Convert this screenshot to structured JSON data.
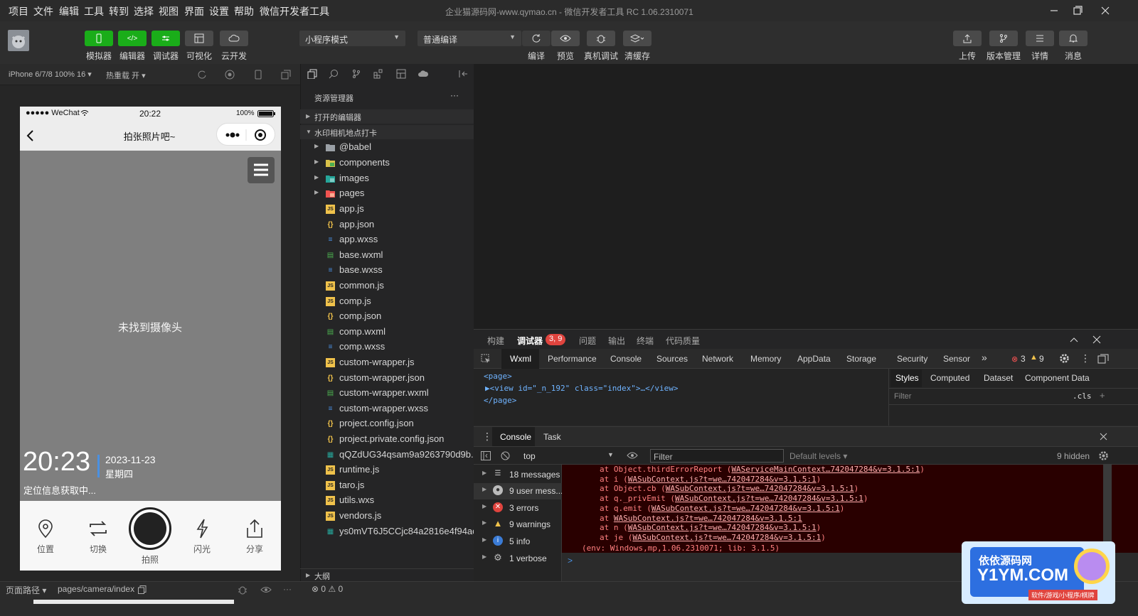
{
  "menubar": {
    "items": [
      "项目",
      "文件",
      "编辑",
      "工具",
      "转到",
      "选择",
      "视图",
      "界面",
      "设置",
      "帮助",
      "微信开发者工具"
    ],
    "window_title": "企业猫源码网-www.qymao.cn - 微信开发者工具 RC 1.06.2310071"
  },
  "toolbar": {
    "buttons": {
      "simulator": "模拟器",
      "editor": "编辑器",
      "debugger": "调试器",
      "visual": "可视化",
      "cloud": "云开发"
    },
    "mode_select": "小程序模式",
    "compile_select": "普通编译",
    "actions": {
      "compile": "编译",
      "preview": "预览",
      "remote_debug": "真机调试",
      "clear_cache": "清缓存"
    },
    "right": {
      "upload": "上传",
      "version": "版本管理",
      "details": "详情",
      "messages": "消息"
    }
  },
  "sim_bar": {
    "device": "iPhone 6/7/8 100% 16 ▾",
    "hot_reload": "热重载 开 ▾"
  },
  "phone": {
    "status": {
      "signal": "●●●●● WeChat",
      "time": "20:22",
      "battery": "100%"
    },
    "nav_title": "拍张照片吧~",
    "camera_msg": "未找到摄像头",
    "overlay": {
      "time": "20:23",
      "date": "2023-11-23",
      "weekday": "星期四",
      "location": "定位信息获取中..."
    },
    "bottom": {
      "location": "位置",
      "switch": "切换",
      "shoot": "拍照",
      "flash": "闪光",
      "share": "分享"
    }
  },
  "explorer": {
    "title": "资源管理器",
    "more": "···",
    "open_editors": "打开的编辑器",
    "project": "水印相机地点打卡",
    "folders": [
      "@babel",
      "components",
      "images",
      "pages"
    ],
    "files": [
      {
        "name": "app.js",
        "type": "js"
      },
      {
        "name": "app.json",
        "type": "json"
      },
      {
        "name": "app.wxss",
        "type": "wxss"
      },
      {
        "name": "base.wxml",
        "type": "wxml"
      },
      {
        "name": "base.wxss",
        "type": "wxss"
      },
      {
        "name": "common.js",
        "type": "js"
      },
      {
        "name": "comp.js",
        "type": "js"
      },
      {
        "name": "comp.json",
        "type": "json"
      },
      {
        "name": "comp.wxml",
        "type": "wxml"
      },
      {
        "name": "comp.wxss",
        "type": "wxss"
      },
      {
        "name": "custom-wrapper.js",
        "type": "js"
      },
      {
        "name": "custom-wrapper.json",
        "type": "json"
      },
      {
        "name": "custom-wrapper.wxml",
        "type": "wxml"
      },
      {
        "name": "custom-wrapper.wxss",
        "type": "wxss"
      },
      {
        "name": "project.config.json",
        "type": "json"
      },
      {
        "name": "project.private.config.json",
        "type": "json"
      },
      {
        "name": "qQZdUG34qsam9a9263790d9b...",
        "type": "img"
      },
      {
        "name": "runtime.js",
        "type": "js"
      },
      {
        "name": "taro.js",
        "type": "js"
      },
      {
        "name": "utils.wxs",
        "type": "js"
      },
      {
        "name": "vendors.js",
        "type": "js"
      },
      {
        "name": "ys0mVT6J5CCjc84a2816e4f94ac...",
        "type": "img"
      }
    ],
    "outline": "大纲",
    "problems": "⊗ 0 ⚠ 0"
  },
  "devtools": {
    "top_tabs": [
      "构建",
      "调试器",
      "问题",
      "输出",
      "终端",
      "代码质量"
    ],
    "debugger_badge": "3, 9",
    "tabs": [
      "Wxml",
      "Performance",
      "Console",
      "Sources",
      "Network",
      "Memory",
      "AppData",
      "Storage",
      "Security",
      "Sensor"
    ],
    "more": "»",
    "err_count": "3",
    "warn_count": "9",
    "wxml": {
      "line1": "<page>",
      "line2": "▶<view id=\"_n_192\" class=\"index\">…</view>",
      "line3": "</page>"
    },
    "styles_tabs": [
      "Styles",
      "Computed",
      "Dataset",
      "Component Data"
    ],
    "styles_filter": "Filter",
    "styles_cls": ".cls",
    "styles_plus": "+",
    "console_tabs": [
      "Console",
      "Task"
    ],
    "context": "top",
    "filter_placeholder": "Filter",
    "levels": "Default levels ▾",
    "hidden": "9 hidden",
    "sidebar": [
      {
        "label": "18 messages",
        "icon": "list"
      },
      {
        "label": "9 user mess...",
        "icon": "user"
      },
      {
        "label": "3 errors",
        "icon": "error"
      },
      {
        "label": "9 warnings",
        "icon": "warning"
      },
      {
        "label": "5 info",
        "icon": "info"
      },
      {
        "label": "1 verbose",
        "icon": "gear"
      }
    ],
    "errors": [
      {
        "pre": "at Object.thirdErrorReport (",
        "link": "WAServiceMainContext…742047284&v=3.1.5:1",
        "post": ")"
      },
      {
        "pre": "at i (",
        "link": "WASubContext.js?t=we…742047284&v=3.1.5:1",
        "post": ")"
      },
      {
        "pre": "at Object.cb (",
        "link": "WASubContext.js?t=we…742047284&v=3.1.5:1",
        "post": ")"
      },
      {
        "pre": "at q._privEmit (",
        "link": "WASubContext.js?t=we…742047284&v=3.1.5:1",
        "post": ")"
      },
      {
        "pre": "at q.emit (",
        "link": "WASubContext.js?t=we…742047284&v=3.1.5:1",
        "post": ")"
      },
      {
        "pre": "at ",
        "link": "WASubContext.js?t=we…742047284&v=3.1.5:1",
        "post": ""
      },
      {
        "pre": "at n (",
        "link": "WASubContext.js?t=we…742047284&v=3.1.5:1",
        "post": ")"
      },
      {
        "pre": "at je (",
        "link": "WASubContext.js?t=we…742047284&v=3.1.5:1",
        "post": ")"
      }
    ],
    "env_line": "(env: Windows,mp,1.06.2310071; lib: 3.1.5)",
    "prompt": ">"
  },
  "statusbar": {
    "path_label": "页面路径 ▾",
    "path": "pages/camera/index"
  },
  "watermark": {
    "line1": "依依源码网",
    "line2": "Y1YM.COM",
    "line3": "软件/游戏/小程序/棋牌"
  },
  "colors": {
    "green": "#1aad19",
    "error": "#ff5555",
    "badge": "#e0443e"
  }
}
